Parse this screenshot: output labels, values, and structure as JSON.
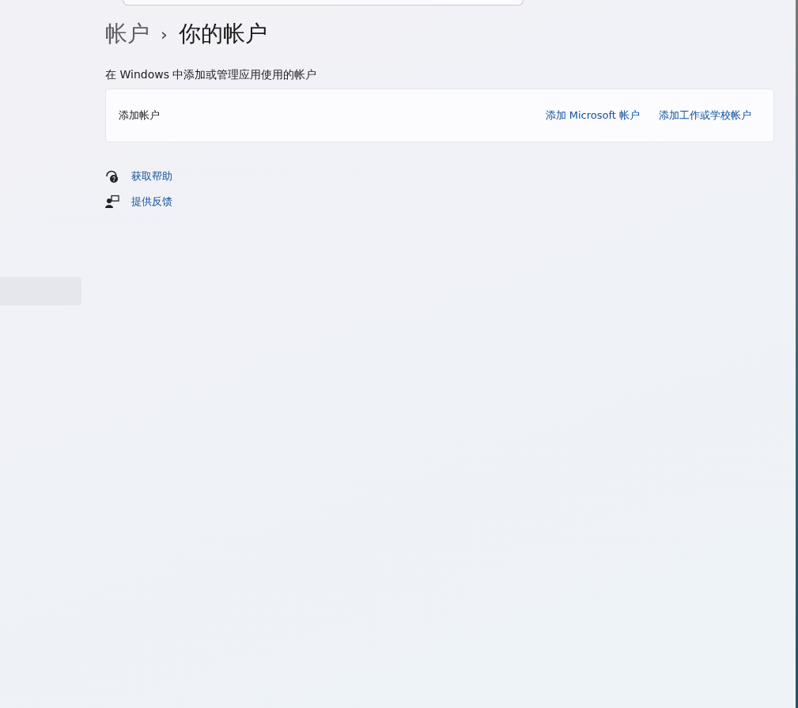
{
  "breadcrumb": {
    "parent": "帐户",
    "separator": "›",
    "current": "你的帐户"
  },
  "section_title": "在 Windows 中添加或管理应用使用的帐户",
  "card": {
    "label": "添加帐户",
    "links": [
      "添加 Microsoft 帐户",
      "添加工作或学校帐户"
    ]
  },
  "help_links": [
    {
      "kind": "help",
      "label": "获取帮助"
    },
    {
      "kind": "feedback",
      "label": "提供反馈"
    }
  ]
}
